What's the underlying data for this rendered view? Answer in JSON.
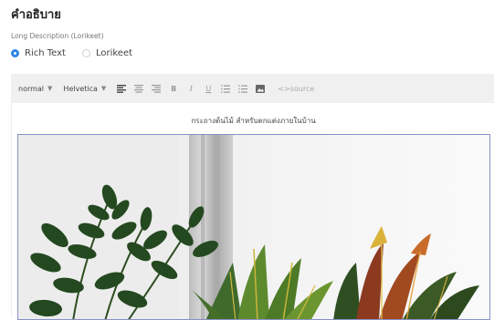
{
  "section": {
    "title": "คำอธิบาย",
    "sub_label": "Long Description (Lorikeet)"
  },
  "radio_options": [
    {
      "label": "Rich Text",
      "checked": true
    },
    {
      "label": "Lorikeet",
      "checked": false
    }
  ],
  "toolbar": {
    "format_select": "normal",
    "font_select": "Helvetica",
    "buttons": [
      "align-left-icon",
      "align-center-icon",
      "align-right-icon",
      "bold-icon",
      "italic-icon",
      "underline-icon",
      "ordered-list-icon",
      "bullet-list-icon",
      "image-icon"
    ],
    "source_label": "<>source"
  },
  "editor": {
    "caption": "กระถางต้นไม้ สำหรับตกแต่งภายในบ้าน",
    "image": {
      "description": "product-photo-plants",
      "accent": "#2f5a2a"
    }
  },
  "colors": {
    "accent": "#2d84e6",
    "toolbar_bg": "#f0f0f0",
    "image_border": "#8a8fc8"
  }
}
